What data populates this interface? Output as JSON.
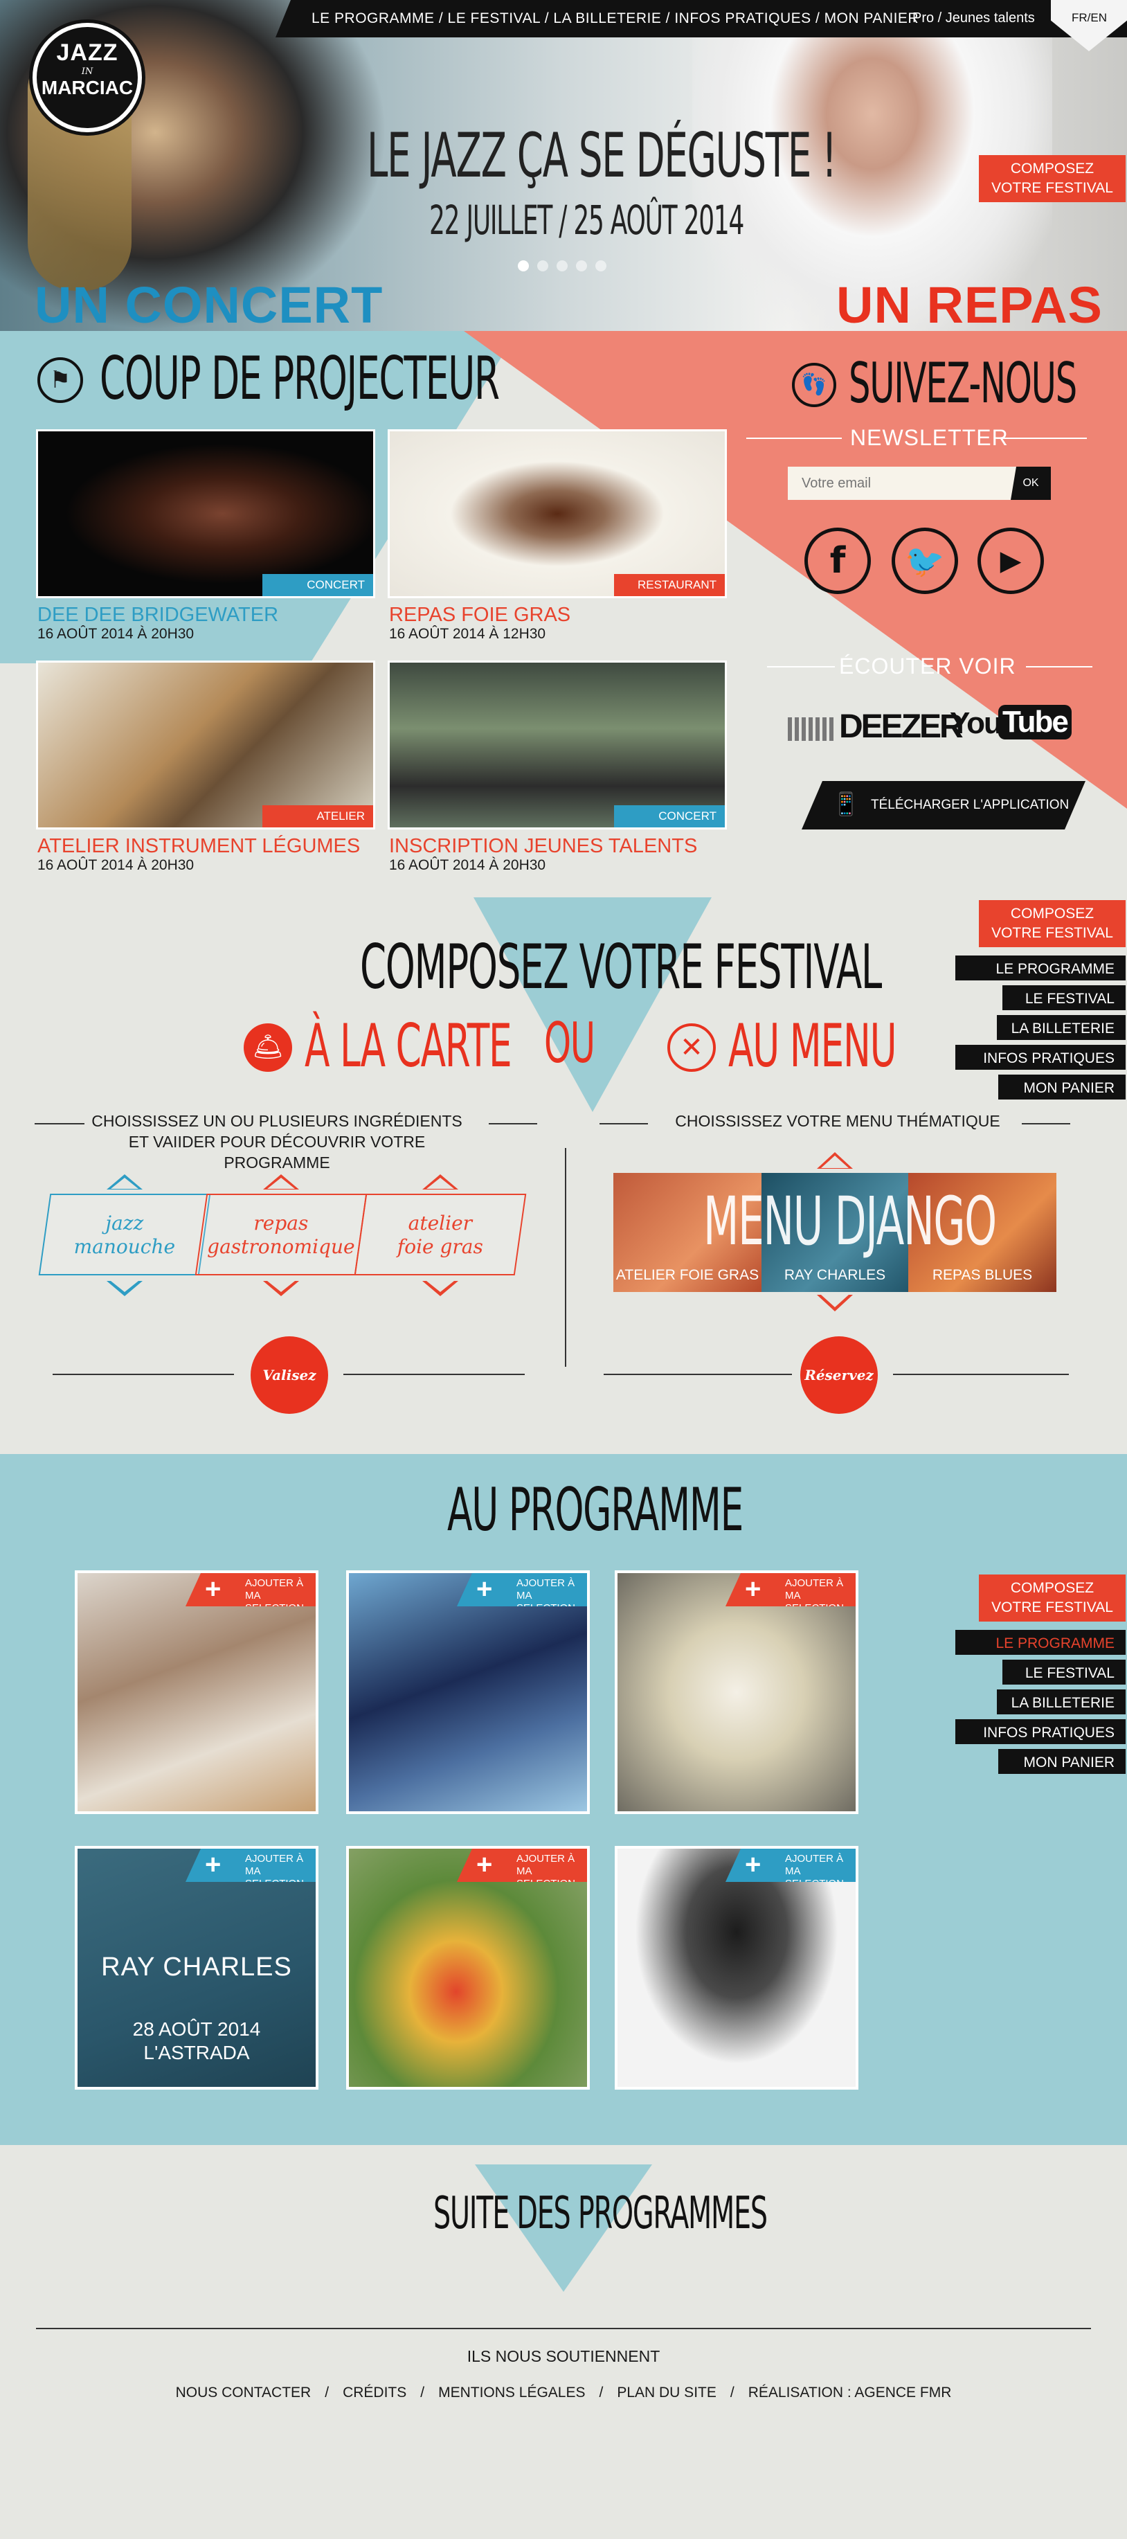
{
  "logo": {
    "line1": "JAZZ",
    "line2": "IN",
    "line3": "MARCIAC"
  },
  "topnav": {
    "links": "LE PROGRAMME / LE FESTIVAL / LA BILLETERIE / INFOS PRATIQUES / MON PANIER",
    "pro": "Pro / Jeunes talents",
    "lang": "FR/EN"
  },
  "hero": {
    "headline": "LE JAZZ ÇA SE DÉGUSTE !",
    "dates": "22 JUILLET / 25 AOÛT 2014",
    "left_word": "UN CONCERT",
    "right_word": "UN REPAS",
    "compose": "COMPOSEZ\nVOTRE FESTIVAL",
    "slides_total": 5,
    "slide_active": 1
  },
  "projecteur": {
    "title": "COUP DE PROJECTEUR",
    "cards": [
      {
        "title": "DEE DEE BRIDGEWATER",
        "date": "16 AOÛT 2014 À 20H30",
        "tag": "CONCERT"
      },
      {
        "title": "REPAS FOIE GRAS",
        "date": "16 AOÛT 2014 À 12H30",
        "tag": "RESTAURANT"
      },
      {
        "title": "ATELIER INSTRUMENT LÉGUMES",
        "date": "16 AOÛT 2014 À 20H30",
        "tag": "ATELIER"
      },
      {
        "title": "INSCRIPTION JEUNES TALENTS",
        "date": "16 AOÛT 2014 À 20H30",
        "tag": "CONCERT"
      }
    ]
  },
  "suivez": {
    "title": "SUIVEZ-NOUS",
    "newsletter": "NEWSLETTER",
    "email_placeholder": "Votre email",
    "ok": "OK",
    "ecouter": "ÉCOUTER VOIR",
    "deezer": "DEEZER",
    "youtube_you": "You",
    "youtube_tube": "Tube",
    "app": "TÉLÉCHARGER L'APPLICATION"
  },
  "sidemenu": {
    "compose": "COMPOSEZ\nVOTRE FESTIVAL",
    "items": [
      "LE PROGRAMME",
      "LE FESTIVAL",
      "LA BILLETERIE",
      "INFOS PRATIQUES",
      "MON PANIER"
    ]
  },
  "compose": {
    "title": "COMPOSEZ VOTRE FESTIVAL",
    "carte": "À LA CARTE",
    "ou": "OU",
    "menu": "AU MENU",
    "carte_text": "CHOISSISSEZ UN OU PLUSIEURS INGRÉDIENTS\nET VAIIDER POUR DÉCOUVRIR VOTRE PROGRAMME",
    "menu_text": "CHOISSISSEZ VOTRE MENU THÉMATIQUE",
    "ingredients": [
      "jazz\nmanouche",
      "repas\ngastronomique",
      "atelier\nfoie gras"
    ],
    "valider": "Valisez",
    "menu_name": "MENU DJANGO",
    "menu_items": [
      "ATELIER FOIE GRAS",
      "RAY CHARLES",
      "REPAS BLUES"
    ],
    "reserver": "Réservez"
  },
  "programme": {
    "title": "AU PROGRAMME",
    "add_label": "AJOUTER À\nMA SELECTION",
    "plus": "+",
    "ray_name": "RAY CHARLES",
    "ray_date": "28 AOÛT 2014\nL'ASTRADA"
  },
  "suite": "SUITE DES PROGRAMMES",
  "footer": {
    "soutien": "ILS NOUS SOUTIENNENT",
    "links": [
      "NOUS CONTACTER",
      "CRÉDITS",
      "MENTIONS LÉGALES",
      "PLAN DU SITE",
      "RÉALISATION : AGENCE FMR"
    ],
    "sep": "/"
  },
  "colors": {
    "red": "#e8432d",
    "blue": "#2e9dc4",
    "teal": "#9ccdd4",
    "salmon": "#ef8474",
    "black": "#111111"
  }
}
